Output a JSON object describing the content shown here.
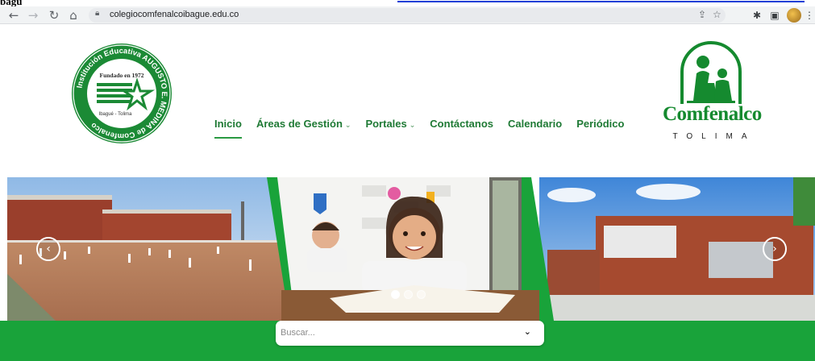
{
  "top_strip": {
    "fragment": "bagu",
    "link_fragment": ""
  },
  "browser": {
    "url": "colegiocomfenalcoibague.edu.co",
    "icons": {
      "back": "arrow-left-icon",
      "forward": "arrow-right-icon",
      "reload": "reload-icon",
      "home": "home-icon",
      "lock": "lock-icon",
      "share": "share-icon",
      "bookmark": "star-icon",
      "extensions": "puzzle-icon",
      "sidepanel": "side-panel-icon",
      "profile": "profile-avatar",
      "menu": "kebab-menu-icon"
    }
  },
  "site": {
    "left_logo": {
      "ring_text": "Institución Educativa AUGUSTO E. MEDINA de Comfenalco",
      "founded": "Fundado en 1972",
      "city": "Ibagué - Tolima"
    },
    "right_logo": {
      "brand": "Comfenalco",
      "region": "TOLIMA"
    },
    "menu": [
      {
        "label": "Inicio",
        "has_dropdown": false,
        "active": true
      },
      {
        "label": "Áreas de Gestión",
        "has_dropdown": true,
        "active": false
      },
      {
        "label": "Portales",
        "has_dropdown": true,
        "active": false
      },
      {
        "label": "Contáctanos",
        "has_dropdown": false,
        "active": false
      },
      {
        "label": "Calendario",
        "has_dropdown": false,
        "active": false
      },
      {
        "label": "Periódico",
        "has_dropdown": false,
        "active": false
      }
    ],
    "slider": {
      "active_dot": 1,
      "dot_count": 3
    },
    "search": {
      "placeholder": "Buscar..."
    },
    "colors": {
      "brand_green": "#19a33a",
      "menu_green": "#1f7a35"
    }
  }
}
